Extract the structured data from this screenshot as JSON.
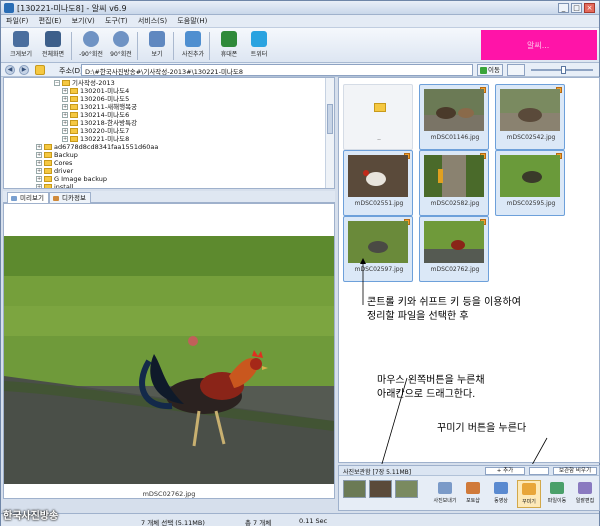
{
  "window": {
    "title": "[130221-미나도8] - 알씨 v6.9"
  },
  "menu": [
    "파일(F)",
    "편집(E)",
    "보기(V)",
    "도구(T)",
    "서비스(S)",
    "도움말(H)"
  ],
  "toolbar": {
    "buttons": [
      "크게보기",
      "전체화면",
      "-90°회전",
      "90°회전",
      "보기",
      "사진추가",
      "휴대폰",
      "트위터"
    ],
    "banner_text": "알씨..."
  },
  "address": {
    "label": "주소(D)",
    "path": "D:\\#한국사진방송#\\기사작성-2013#\\130221-미나도8",
    "go": "이동"
  },
  "tree": {
    "items": [
      {
        "label": "기사작성-2013",
        "level": 1
      },
      {
        "label": "130201-미나도4",
        "level": 2
      },
      {
        "label": "130206-미나도5",
        "level": 2
      },
      {
        "label": "130211-새해행복궁",
        "level": 2
      },
      {
        "label": "130214-미나도6",
        "level": 2
      },
      {
        "label": "130218-한사방특강",
        "level": 2
      },
      {
        "label": "130220-미나도7",
        "level": 2
      },
      {
        "label": "130221-미나도8",
        "level": 2
      },
      {
        "label": "ad6778d8cd8341faa1551d60aa",
        "level": 0
      },
      {
        "label": "Backup",
        "level": 0
      },
      {
        "label": "Cores",
        "level": 0
      },
      {
        "label": "driver",
        "level": 0
      },
      {
        "label": "G Image backup",
        "level": 0
      },
      {
        "label": "install",
        "level": 0
      }
    ]
  },
  "preview_tabs": [
    "미리보기",
    "디카정보"
  ],
  "preview": {
    "filename": "mDSC02762.jpg"
  },
  "thumbnails": [
    {
      "name": "..",
      "parent": true
    },
    {
      "name": "mDSC01146.jpg"
    },
    {
      "name": "mDSC02542.jpg"
    },
    {
      "name": "mDSC02551.jpg"
    },
    {
      "name": "mDSC02582.jpg"
    },
    {
      "name": "mDSC02595.jpg"
    },
    {
      "name": "mDSC02597.jpg"
    },
    {
      "name": "mDSC02762.jpg"
    }
  ],
  "annotations": {
    "a1_line1": "콘트롤 키와 쉬프트 키 등을 이용하여",
    "a1_line2": "정리할 파일을 선택한 후",
    "a2_line1": "마우스 왼쪽버튼을 누른채",
    "a2_line2": "아래칸으로 드래그한다.",
    "a3": "꾸미기 버튼을 누른다"
  },
  "basket": {
    "title": "사진보관함",
    "count": "[7장 5.11MB]",
    "add": "+ 추가",
    "clear": "보관함 비우기",
    "tools": [
      "사진보내기",
      "포토샵",
      "동영상",
      "꾸미기",
      "파일이동",
      "일괄편집"
    ]
  },
  "status": {
    "selected": "7 개체 선택 (5.11MB)",
    "total": "총 7 개체",
    "time": "0.11 Sec",
    "logo": "한국사진방송"
  },
  "colors": {
    "banner": "#ff14a8",
    "selection": "#6da0da",
    "chrome": "#d6dfec"
  }
}
